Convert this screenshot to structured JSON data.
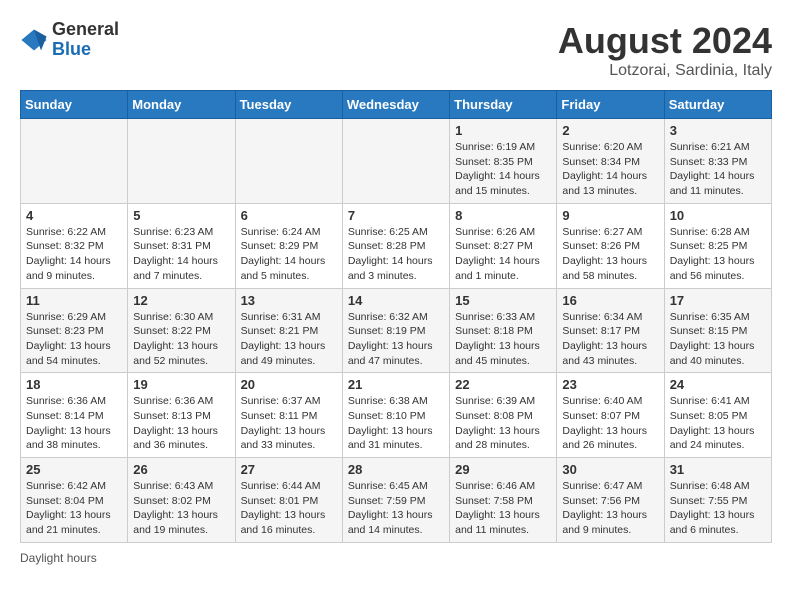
{
  "logo": {
    "general": "General",
    "blue": "Blue"
  },
  "title": "August 2024",
  "subtitle": "Lotzorai, Sardinia, Italy",
  "days_of_week": [
    "Sunday",
    "Monday",
    "Tuesday",
    "Wednesday",
    "Thursday",
    "Friday",
    "Saturday"
  ],
  "weeks": [
    [
      {
        "day": "",
        "info": ""
      },
      {
        "day": "",
        "info": ""
      },
      {
        "day": "",
        "info": ""
      },
      {
        "day": "",
        "info": ""
      },
      {
        "day": "1",
        "info": "Sunrise: 6:19 AM\nSunset: 8:35 PM\nDaylight: 14 hours and 15 minutes."
      },
      {
        "day": "2",
        "info": "Sunrise: 6:20 AM\nSunset: 8:34 PM\nDaylight: 14 hours and 13 minutes."
      },
      {
        "day": "3",
        "info": "Sunrise: 6:21 AM\nSunset: 8:33 PM\nDaylight: 14 hours and 11 minutes."
      }
    ],
    [
      {
        "day": "4",
        "info": "Sunrise: 6:22 AM\nSunset: 8:32 PM\nDaylight: 14 hours and 9 minutes."
      },
      {
        "day": "5",
        "info": "Sunrise: 6:23 AM\nSunset: 8:31 PM\nDaylight: 14 hours and 7 minutes."
      },
      {
        "day": "6",
        "info": "Sunrise: 6:24 AM\nSunset: 8:29 PM\nDaylight: 14 hours and 5 minutes."
      },
      {
        "day": "7",
        "info": "Sunrise: 6:25 AM\nSunset: 8:28 PM\nDaylight: 14 hours and 3 minutes."
      },
      {
        "day": "8",
        "info": "Sunrise: 6:26 AM\nSunset: 8:27 PM\nDaylight: 14 hours and 1 minute."
      },
      {
        "day": "9",
        "info": "Sunrise: 6:27 AM\nSunset: 8:26 PM\nDaylight: 13 hours and 58 minutes."
      },
      {
        "day": "10",
        "info": "Sunrise: 6:28 AM\nSunset: 8:25 PM\nDaylight: 13 hours and 56 minutes."
      }
    ],
    [
      {
        "day": "11",
        "info": "Sunrise: 6:29 AM\nSunset: 8:23 PM\nDaylight: 13 hours and 54 minutes."
      },
      {
        "day": "12",
        "info": "Sunrise: 6:30 AM\nSunset: 8:22 PM\nDaylight: 13 hours and 52 minutes."
      },
      {
        "day": "13",
        "info": "Sunrise: 6:31 AM\nSunset: 8:21 PM\nDaylight: 13 hours and 49 minutes."
      },
      {
        "day": "14",
        "info": "Sunrise: 6:32 AM\nSunset: 8:19 PM\nDaylight: 13 hours and 47 minutes."
      },
      {
        "day": "15",
        "info": "Sunrise: 6:33 AM\nSunset: 8:18 PM\nDaylight: 13 hours and 45 minutes."
      },
      {
        "day": "16",
        "info": "Sunrise: 6:34 AM\nSunset: 8:17 PM\nDaylight: 13 hours and 43 minutes."
      },
      {
        "day": "17",
        "info": "Sunrise: 6:35 AM\nSunset: 8:15 PM\nDaylight: 13 hours and 40 minutes."
      }
    ],
    [
      {
        "day": "18",
        "info": "Sunrise: 6:36 AM\nSunset: 8:14 PM\nDaylight: 13 hours and 38 minutes."
      },
      {
        "day": "19",
        "info": "Sunrise: 6:36 AM\nSunset: 8:13 PM\nDaylight: 13 hours and 36 minutes."
      },
      {
        "day": "20",
        "info": "Sunrise: 6:37 AM\nSunset: 8:11 PM\nDaylight: 13 hours and 33 minutes."
      },
      {
        "day": "21",
        "info": "Sunrise: 6:38 AM\nSunset: 8:10 PM\nDaylight: 13 hours and 31 minutes."
      },
      {
        "day": "22",
        "info": "Sunrise: 6:39 AM\nSunset: 8:08 PM\nDaylight: 13 hours and 28 minutes."
      },
      {
        "day": "23",
        "info": "Sunrise: 6:40 AM\nSunset: 8:07 PM\nDaylight: 13 hours and 26 minutes."
      },
      {
        "day": "24",
        "info": "Sunrise: 6:41 AM\nSunset: 8:05 PM\nDaylight: 13 hours and 24 minutes."
      }
    ],
    [
      {
        "day": "25",
        "info": "Sunrise: 6:42 AM\nSunset: 8:04 PM\nDaylight: 13 hours and 21 minutes."
      },
      {
        "day": "26",
        "info": "Sunrise: 6:43 AM\nSunset: 8:02 PM\nDaylight: 13 hours and 19 minutes."
      },
      {
        "day": "27",
        "info": "Sunrise: 6:44 AM\nSunset: 8:01 PM\nDaylight: 13 hours and 16 minutes."
      },
      {
        "day": "28",
        "info": "Sunrise: 6:45 AM\nSunset: 7:59 PM\nDaylight: 13 hours and 14 minutes."
      },
      {
        "day": "29",
        "info": "Sunrise: 6:46 AM\nSunset: 7:58 PM\nDaylight: 13 hours and 11 minutes."
      },
      {
        "day": "30",
        "info": "Sunrise: 6:47 AM\nSunset: 7:56 PM\nDaylight: 13 hours and 9 minutes."
      },
      {
        "day": "31",
        "info": "Sunrise: 6:48 AM\nSunset: 7:55 PM\nDaylight: 13 hours and 6 minutes."
      }
    ]
  ],
  "footer_note": "Daylight hours"
}
